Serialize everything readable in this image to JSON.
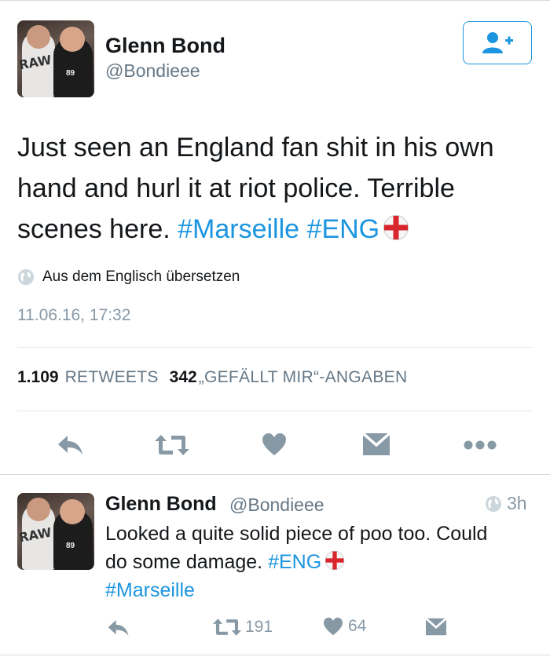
{
  "tweet": {
    "author_name": "Glenn Bond",
    "author_handle": "@Bondieee",
    "text_plain": "Just seen an England fan shit in his own hand and hurl it at riot police. Terrible scenes here.",
    "hashtag_1": "#Marseille",
    "hashtag_2": "#ENG",
    "translate_label": "Aus dem Englisch übersetzen",
    "timestamp": "11.06.16, 17:32",
    "retweets_count": "1.109",
    "retweets_label": "RETWEETS",
    "likes_count": "342",
    "likes_label": "„GEFÄLLT MIR“-ANGABEN"
  },
  "reply": {
    "author_name": "Glenn Bond",
    "author_handle": "@Bondieee",
    "age": "3h",
    "text_plain": "Looked a quite solid piece of poo too. Could do some damage.",
    "hashtag_1": "#ENG",
    "hashtag_2": "#Marseille",
    "retweets_count": "191",
    "likes_count": "64"
  },
  "avatar": {
    "shirt_text": "RAW",
    "shirt_number": "89"
  },
  "icons": {
    "follow": "add-user-icon",
    "translate": "globe-icon",
    "reply": "reply-icon",
    "retweet": "retweet-icon",
    "like": "heart-icon",
    "dm": "envelope-icon",
    "more": "more-icon",
    "flag": "england-flag-icon"
  },
  "colors": {
    "accent": "#1b95e0",
    "icon_gray": "#8899a6",
    "text": "#14171a",
    "secondary": "#657786"
  }
}
